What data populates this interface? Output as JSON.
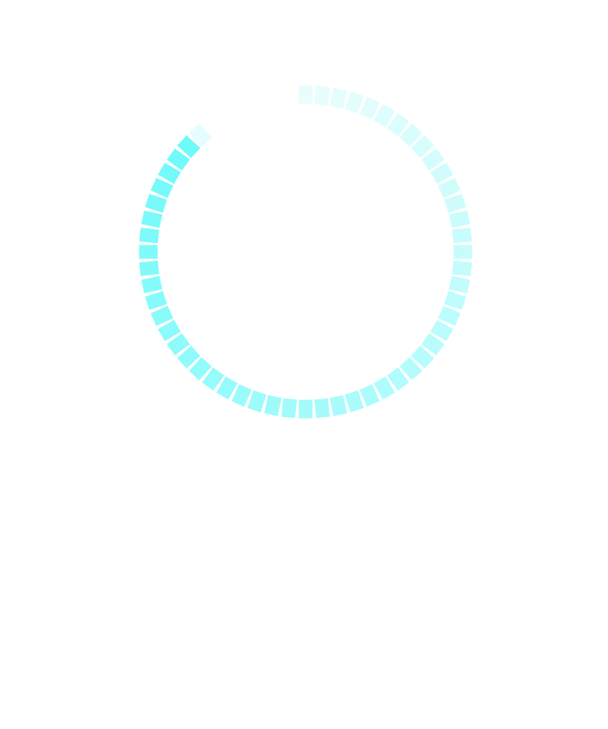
{
  "loader": {
    "type": "segmented-ring-spinner",
    "segment_count": 60,
    "visible_segments": 54,
    "start_angle_deg": -90,
    "direction": "clockwise",
    "color_lightest": "#eafdfd",
    "color_darkest": "#6ffafa",
    "gap_color": "#ffffff"
  }
}
